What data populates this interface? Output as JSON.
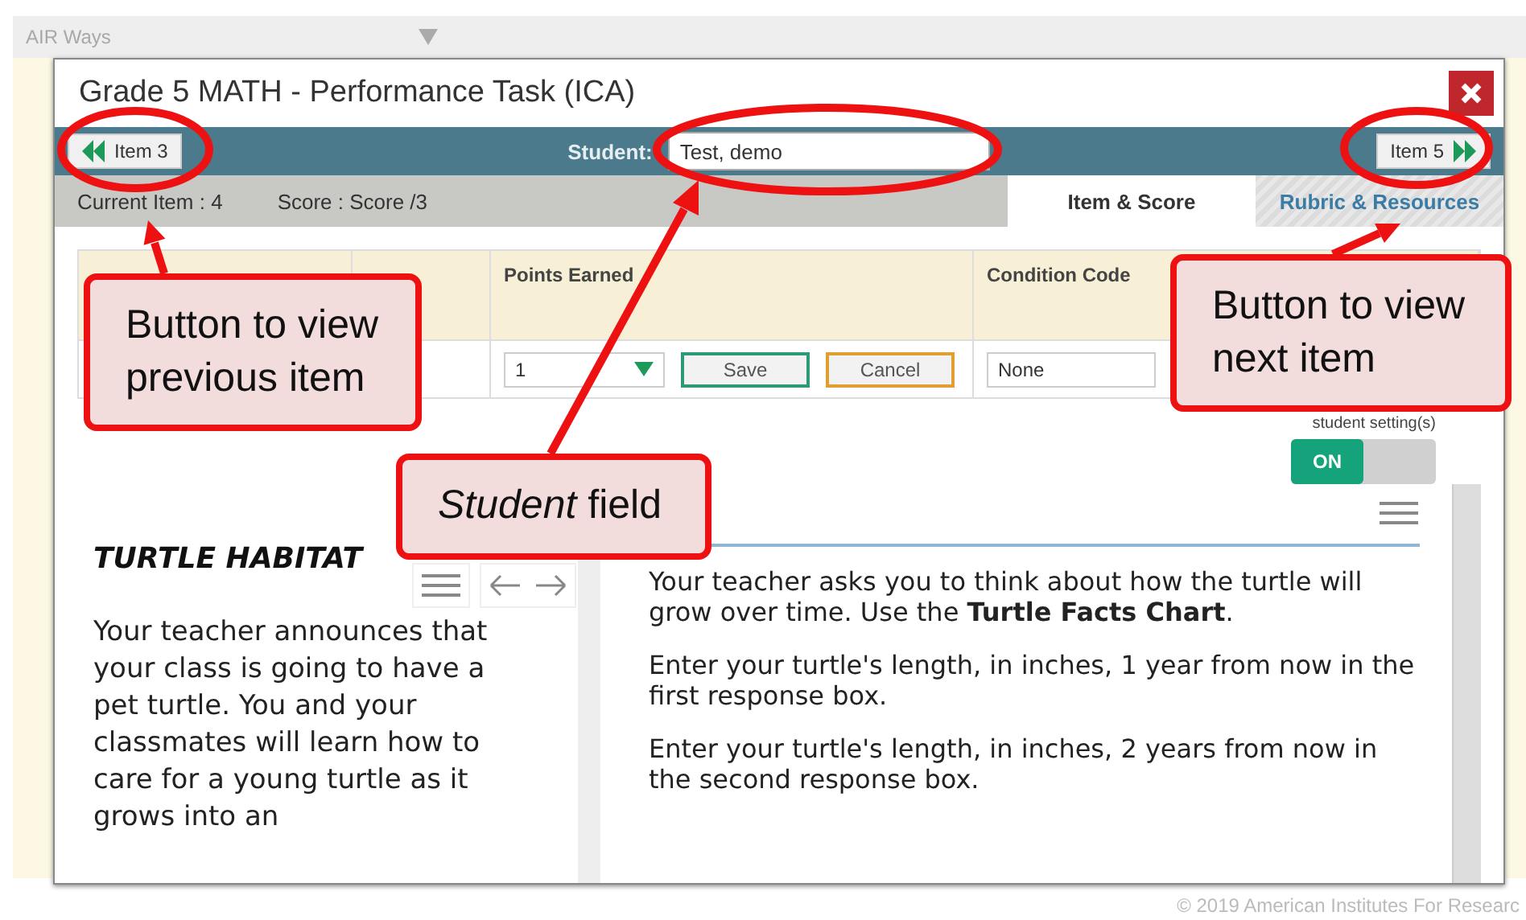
{
  "background_app": {
    "title": "AIR Ways"
  },
  "dialog": {
    "title": "Grade 5 MATH - Performance Task (ICA)"
  },
  "nav": {
    "prev_button": "Item 3",
    "student_label": "Student:",
    "student_value": "Test, demo",
    "next_button": "Item 5"
  },
  "info": {
    "current_item": "Current Item : 4",
    "score": "Score : Score /3"
  },
  "tabs": [
    {
      "label": "Item & Score",
      "selected": true
    },
    {
      "label": "Rubric & Resources",
      "selected": false
    }
  ],
  "score_table": {
    "columns": [
      "Points Earned",
      "Condition Code"
    ],
    "points": "1",
    "save": "Save",
    "cancel": "Cancel",
    "condition": "None"
  },
  "student_settings": {
    "label": "student setting(s)",
    "toggle_label": "ON",
    "on": true
  },
  "passage": {
    "title": "TURTLE HABITAT",
    "text": "Your teacher announces that your class is going to have a pet turtle. You and your classmates will learn how to care for a young turtle as it grows into an"
  },
  "question": {
    "paragraphs": [
      "Your teacher asks you to think about how the turtle will grow over time. Use the **Turtle Facts Chart**.",
      "Enter your turtle's length, in inches, 1 year from now in the first response box.",
      "Enter your turtle's length, in inches, 2 years from now in the second response box."
    ]
  },
  "callouts": [
    {
      "text": "Button to view previous item"
    },
    {
      "text": "*Student* field"
    },
    {
      "text": "Button to view next item"
    }
  ],
  "footer": "© 2019 American Institutes For Researc"
}
